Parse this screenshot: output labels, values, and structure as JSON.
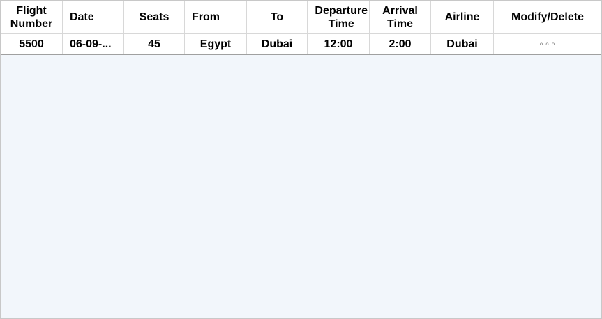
{
  "columns": [
    "Flight\nNumber",
    "Date",
    "Seats",
    "From",
    "To",
    "Departure\nTime",
    "Arrival\nTime",
    "Airline",
    "Modify/Delete"
  ],
  "rows": [
    {
      "flight_number": "5500",
      "date": "06-09-...",
      "seats": "45",
      "from": "Egypt",
      "to": "Dubai",
      "departure_time": "12:00",
      "arrival_time": "2:00",
      "airline": "Dubai",
      "actions": "∘∘∘"
    }
  ]
}
